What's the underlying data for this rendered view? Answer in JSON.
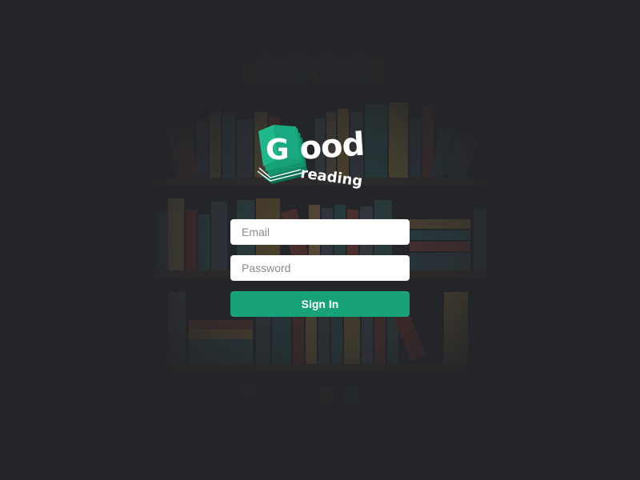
{
  "app": {
    "logo_word": "ood",
    "logo_letter": "G",
    "logo_sub": "reading"
  },
  "login": {
    "email_placeholder": "Email",
    "password_placeholder": "Password",
    "signin_label": "Sign In"
  },
  "colors": {
    "background": "#242528",
    "accent": "#17a27a",
    "field_bg": "#ffffff"
  },
  "icons": {
    "logo": "book-stack-icon"
  }
}
